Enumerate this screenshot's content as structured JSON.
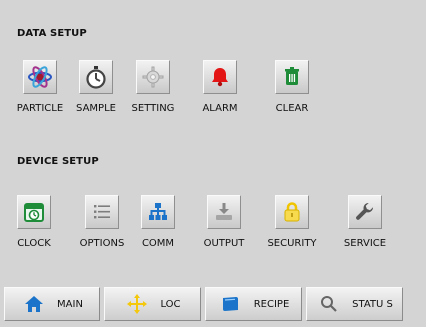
{
  "data_setup": {
    "title": "DATA SETUP",
    "items": [
      {
        "label": "PARTICLE",
        "icon": "particle-icon"
      },
      {
        "label": "SAMPLE",
        "icon": "stopwatch-icon"
      },
      {
        "label": "SETTING",
        "icon": "gear-icon"
      },
      {
        "label": "ALARM",
        "icon": "bell-icon"
      },
      {
        "label": "CLEAR",
        "icon": "trash-icon"
      }
    ]
  },
  "device_setup": {
    "title": "DEVICE SETUP",
    "items": [
      {
        "label": "CLOCK",
        "icon": "calendar-clock-icon"
      },
      {
        "label": "OPTIONS",
        "icon": "list-icon"
      },
      {
        "label": "COMM",
        "icon": "network-icon"
      },
      {
        "label": "OUTPUT",
        "icon": "download-icon"
      },
      {
        "label": "SECURITY",
        "icon": "lock-icon"
      },
      {
        "label": "SERVICE",
        "icon": "wrench-icon"
      }
    ]
  },
  "nav": {
    "main": {
      "label": "MAIN",
      "icon": "home-icon"
    },
    "loc": {
      "label": "LOC",
      "icon": "move-arrows-icon"
    },
    "recipe": {
      "label": "RECIPE",
      "icon": "book-icon"
    },
    "status": {
      "label": "STATU S",
      "icon": "search-icon"
    }
  },
  "colors": {
    "background": "#d4d4d4",
    "text": "#111111",
    "accent_blue": "#1b74c9",
    "accent_green": "#1f8c3a",
    "accent_red": "#d41414",
    "accent_yellow": "#f4c80d"
  }
}
